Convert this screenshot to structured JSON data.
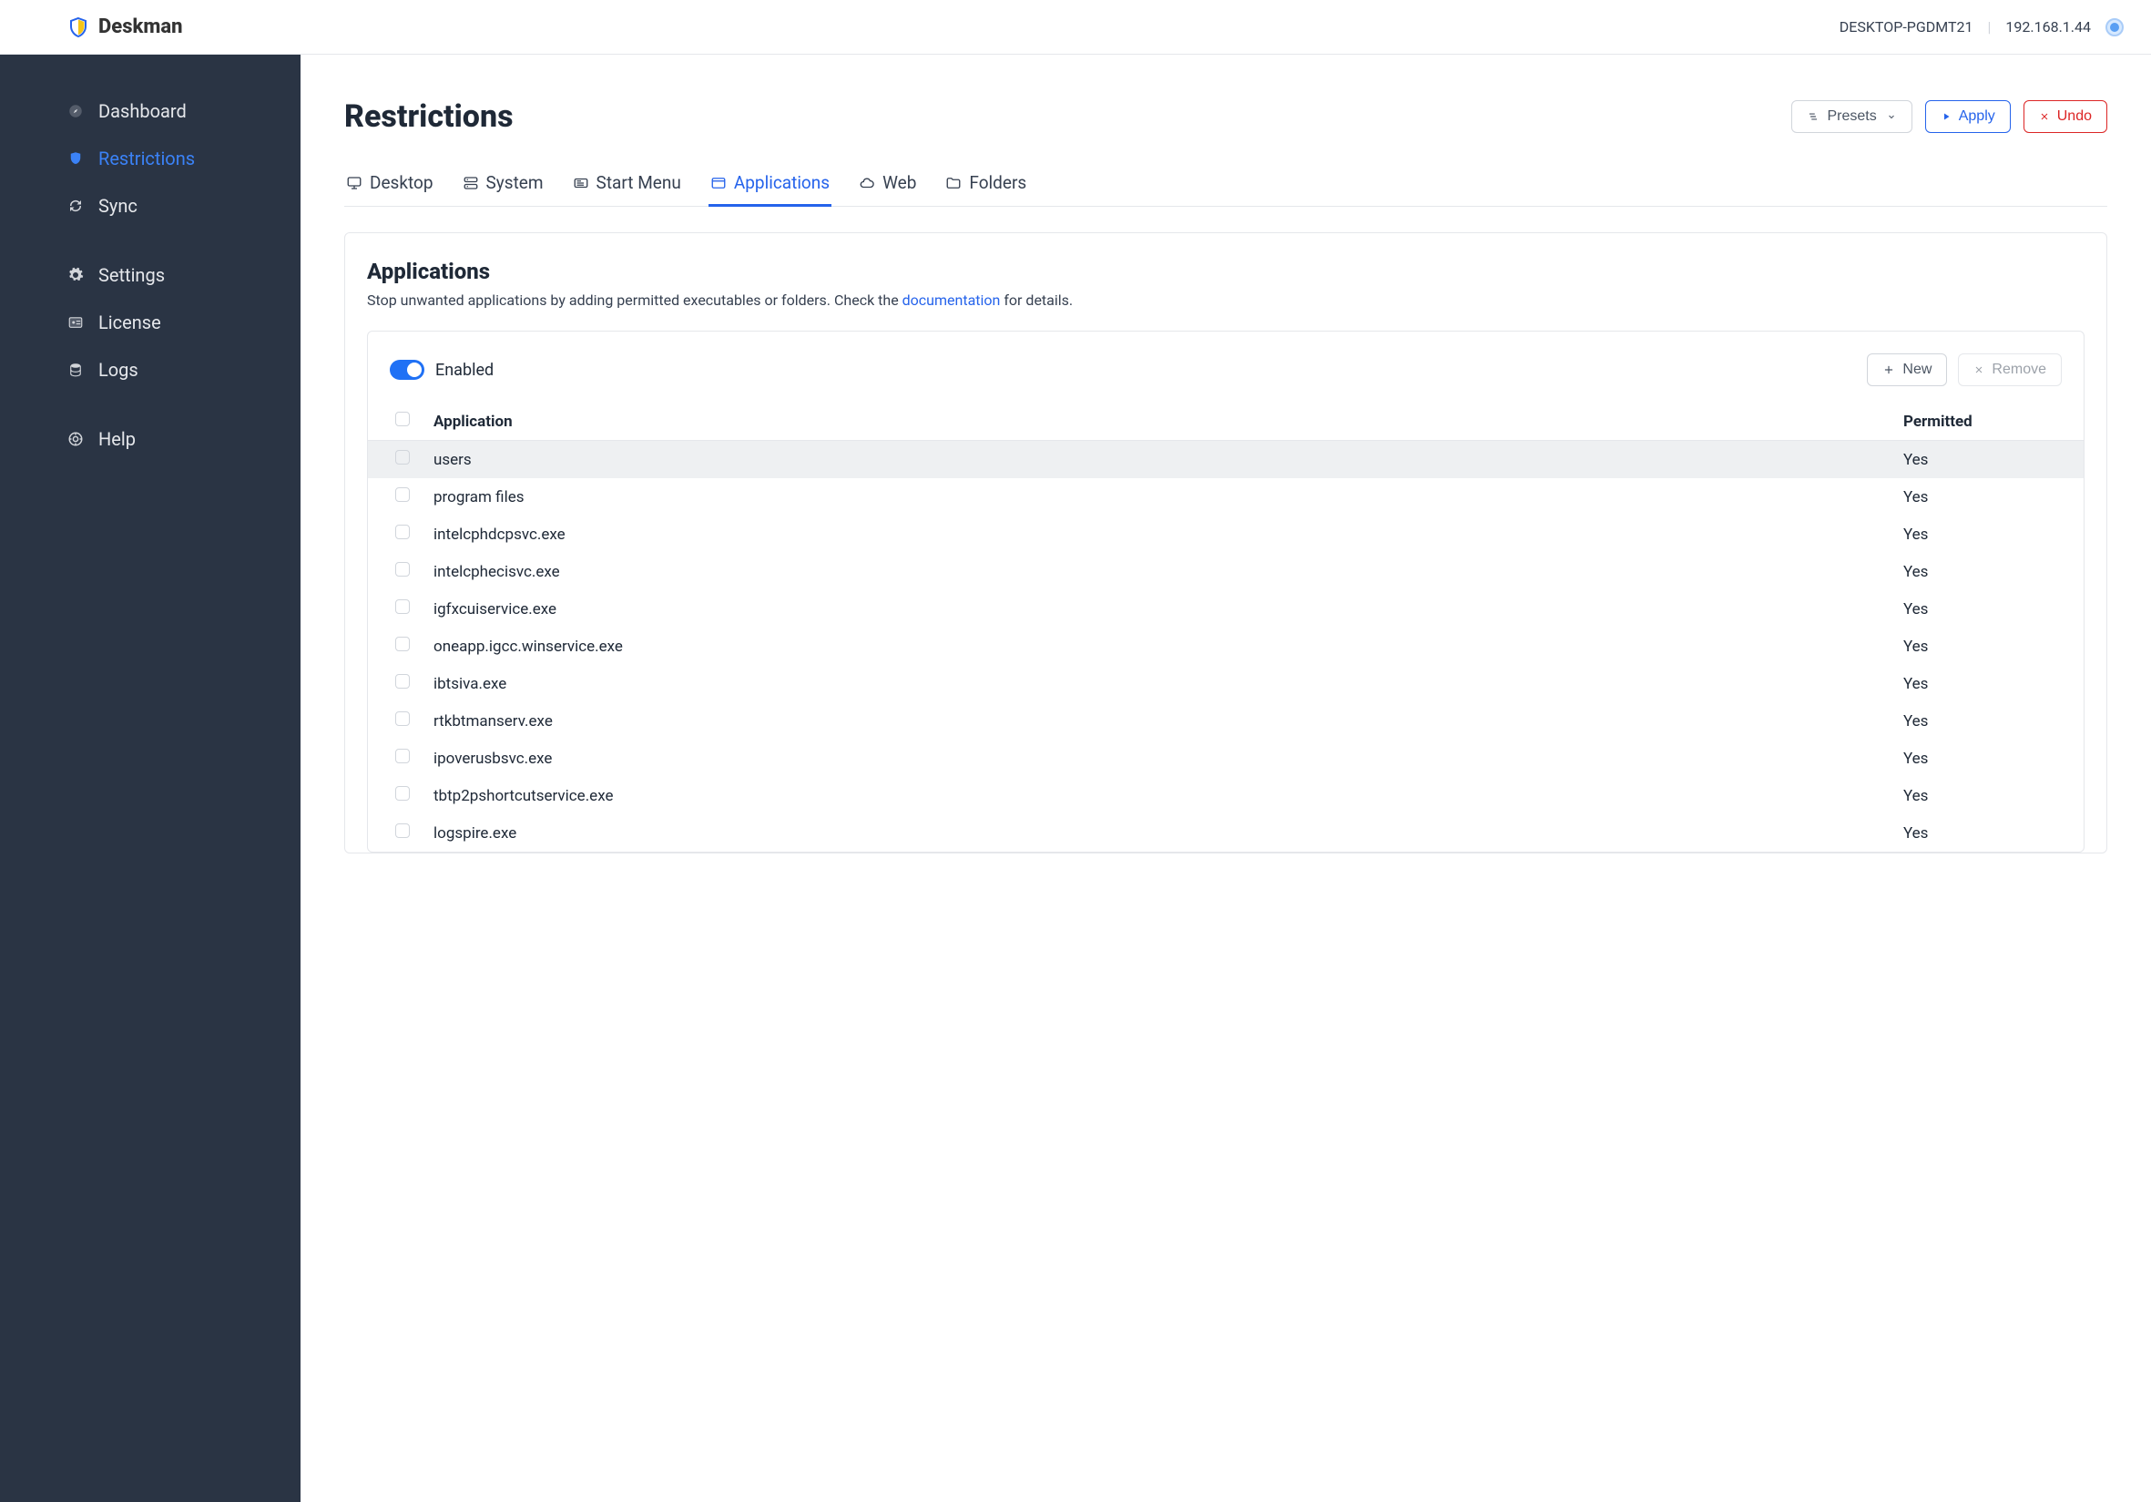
{
  "brand": {
    "name": "Deskman"
  },
  "header": {
    "hostname": "DESKTOP-PGDMT21",
    "ip": "192.168.1.44"
  },
  "sidebar": {
    "items": [
      {
        "label": "Dashboard",
        "icon": "compass-icon",
        "active": false
      },
      {
        "label": "Restrictions",
        "icon": "shield-icon",
        "active": true
      },
      {
        "label": "Sync",
        "icon": "sync-icon",
        "active": false
      }
    ],
    "items2": [
      {
        "label": "Settings",
        "icon": "gear-icon"
      },
      {
        "label": "License",
        "icon": "id-icon"
      },
      {
        "label": "Logs",
        "icon": "db-icon"
      }
    ],
    "items3": [
      {
        "label": "Help",
        "icon": "life-ring-icon"
      }
    ]
  },
  "page": {
    "title": "Restrictions",
    "buttons": {
      "presets": "Presets",
      "apply": "Apply",
      "undo": "Undo"
    }
  },
  "tabs": [
    {
      "label": "Desktop",
      "icon": "monitor-icon",
      "active": false
    },
    {
      "label": "System",
      "icon": "server-icon",
      "active": false
    },
    {
      "label": "Start Menu",
      "icon": "startmenu-icon",
      "active": false
    },
    {
      "label": "Applications",
      "icon": "window-icon",
      "active": true
    },
    {
      "label": "Web",
      "icon": "cloud-icon",
      "active": false
    },
    {
      "label": "Folders",
      "icon": "folder-icon",
      "active": false
    }
  ],
  "panel": {
    "title": "Applications",
    "desc_pre": "Stop unwanted applications by adding permitted executables or folders. Check the ",
    "desc_link": "documentation",
    "desc_post": " for details.",
    "enabled_label": "Enabled",
    "btn_new": "New",
    "btn_remove": "Remove",
    "columns": {
      "app": "Application",
      "perm": "Permitted"
    },
    "rows": [
      {
        "app": "users",
        "perm": "Yes",
        "hi": true
      },
      {
        "app": "program files",
        "perm": "Yes",
        "hi": false
      },
      {
        "app": "intelcphdcpsvc.exe",
        "perm": "Yes",
        "hi": false
      },
      {
        "app": "intelcphecisvc.exe",
        "perm": "Yes",
        "hi": false
      },
      {
        "app": "igfxcuiservice.exe",
        "perm": "Yes",
        "hi": false
      },
      {
        "app": "oneapp.igcc.winservice.exe",
        "perm": "Yes",
        "hi": false
      },
      {
        "app": "ibtsiva.exe",
        "perm": "Yes",
        "hi": false
      },
      {
        "app": "rtkbtmanserv.exe",
        "perm": "Yes",
        "hi": false
      },
      {
        "app": "ipoverusbsvc.exe",
        "perm": "Yes",
        "hi": false
      },
      {
        "app": "tbtp2pshortcutservice.exe",
        "perm": "Yes",
        "hi": false
      },
      {
        "app": "logspire.exe",
        "perm": "Yes",
        "hi": false
      }
    ]
  }
}
